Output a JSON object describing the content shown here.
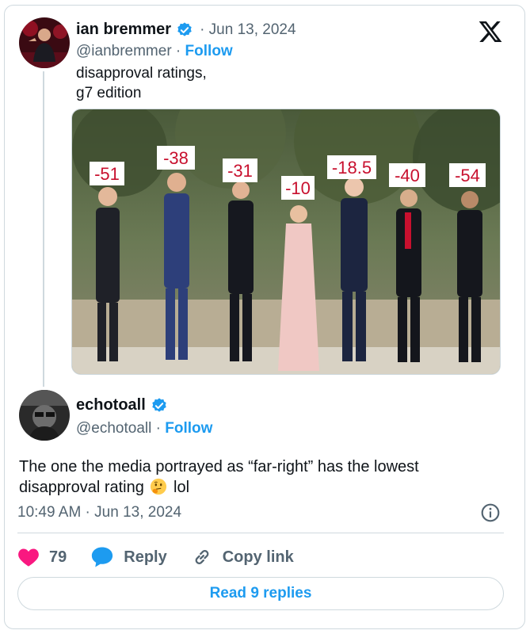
{
  "tweet": {
    "author_name": "ian bremmer",
    "date": "Jun 13, 2024",
    "handle": "@ianbremmer",
    "follow_label": "Follow",
    "text_line1": "disapproval ratings,",
    "text_line2": "g7 edition",
    "photo_labels": [
      "-51",
      "-38",
      "-31",
      "-10",
      "-18.5",
      "-40",
      "-54"
    ]
  },
  "reply": {
    "author_name": "echotoall",
    "handle": "@echotoall",
    "follow_label": "Follow",
    "text_line1": "The one the media portrayed as “far-right” has the lowest",
    "text_line2_before": "disapproval rating",
    "text_line2_after": "lol",
    "emoji": "thinking-face",
    "timestamp": "10:49 AM · Jun 13, 2024",
    "likes": "79",
    "reply_label": "Reply",
    "copy_link_label": "Copy link",
    "read_replies_label": "Read 9 replies"
  },
  "colors": {
    "accent": "#1d9bf0",
    "heart": "#f91880",
    "muted": "#536471",
    "border": "#cfd9de"
  }
}
